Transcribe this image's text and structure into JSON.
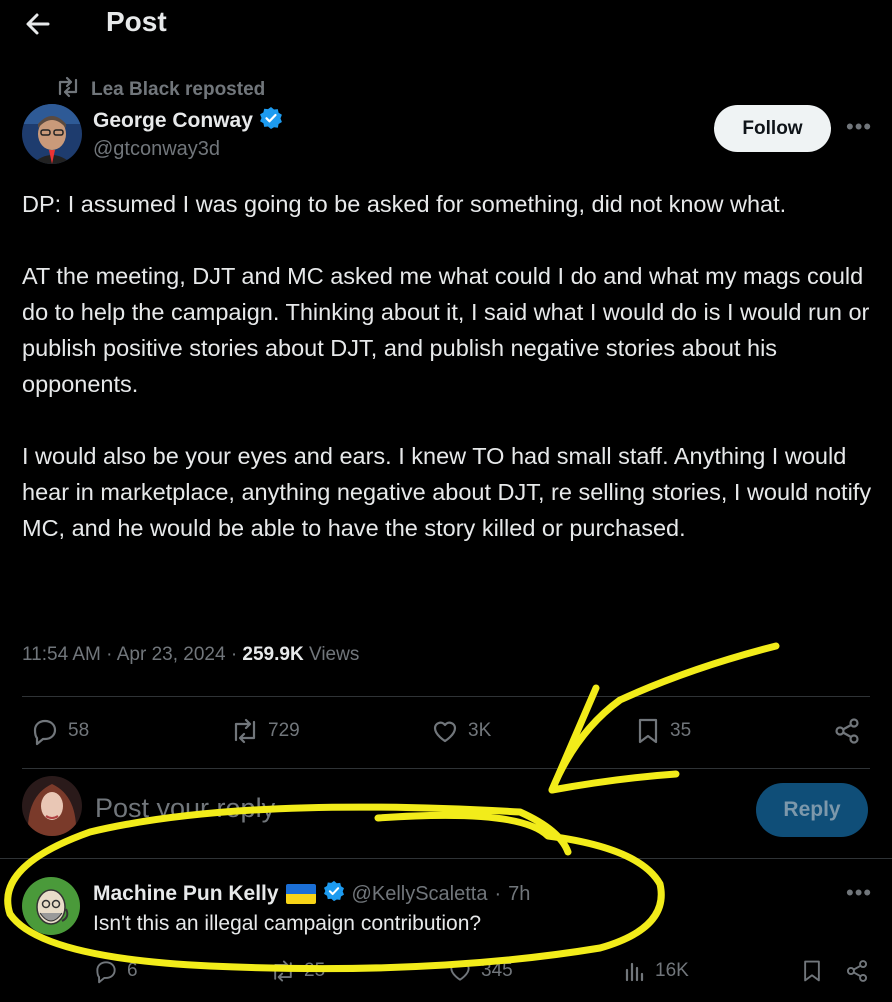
{
  "header": {
    "title": "Post"
  },
  "repost": {
    "label": "Lea Black reposted"
  },
  "author": {
    "name": "George Conway",
    "handle": "@gtconway3d",
    "verified": true
  },
  "follow_label": "Follow",
  "tweet": {
    "paragraphs": [
      "DP:  I assumed I was going to be asked for something, did not know what.",
      "AT the meeting, DJT and MC asked me what could I do and what my mags could do to help the campaign.  Thinking about it, I said what I would do is I would run or publish positive stories about DJT, and publish negative stories about his opponents.",
      "I would also be your eyes and ears.  I knew TO had small staff.  Anything I would hear in marketplace, anything negative about DJT, re selling stories, I would notify MC, and he would be able to have the story killed or purchased."
    ],
    "time": "11:54 AM",
    "date": "Apr 23, 2024",
    "views_count": "259.9K",
    "views_label": "Views",
    "separator": "·"
  },
  "actions": {
    "replies": "58",
    "reposts": "729",
    "likes": "3K",
    "bookmarks": "35"
  },
  "reply_box": {
    "placeholder": "Post your reply",
    "button_label": "Reply"
  },
  "reply": {
    "name": "Machine Pun Kelly",
    "handle": "@KellyScaletta",
    "separator": "·",
    "age": "7h",
    "text": "Isn't this an illegal campaign contribution?",
    "actions": {
      "replies": "6",
      "reposts": "25",
      "likes": "345",
      "views": "16K"
    }
  },
  "colors": {
    "background": "#000000",
    "verified": "#1d9bf0",
    "annotation": "#f2ec1a",
    "reply_button": "#0f4e78"
  }
}
